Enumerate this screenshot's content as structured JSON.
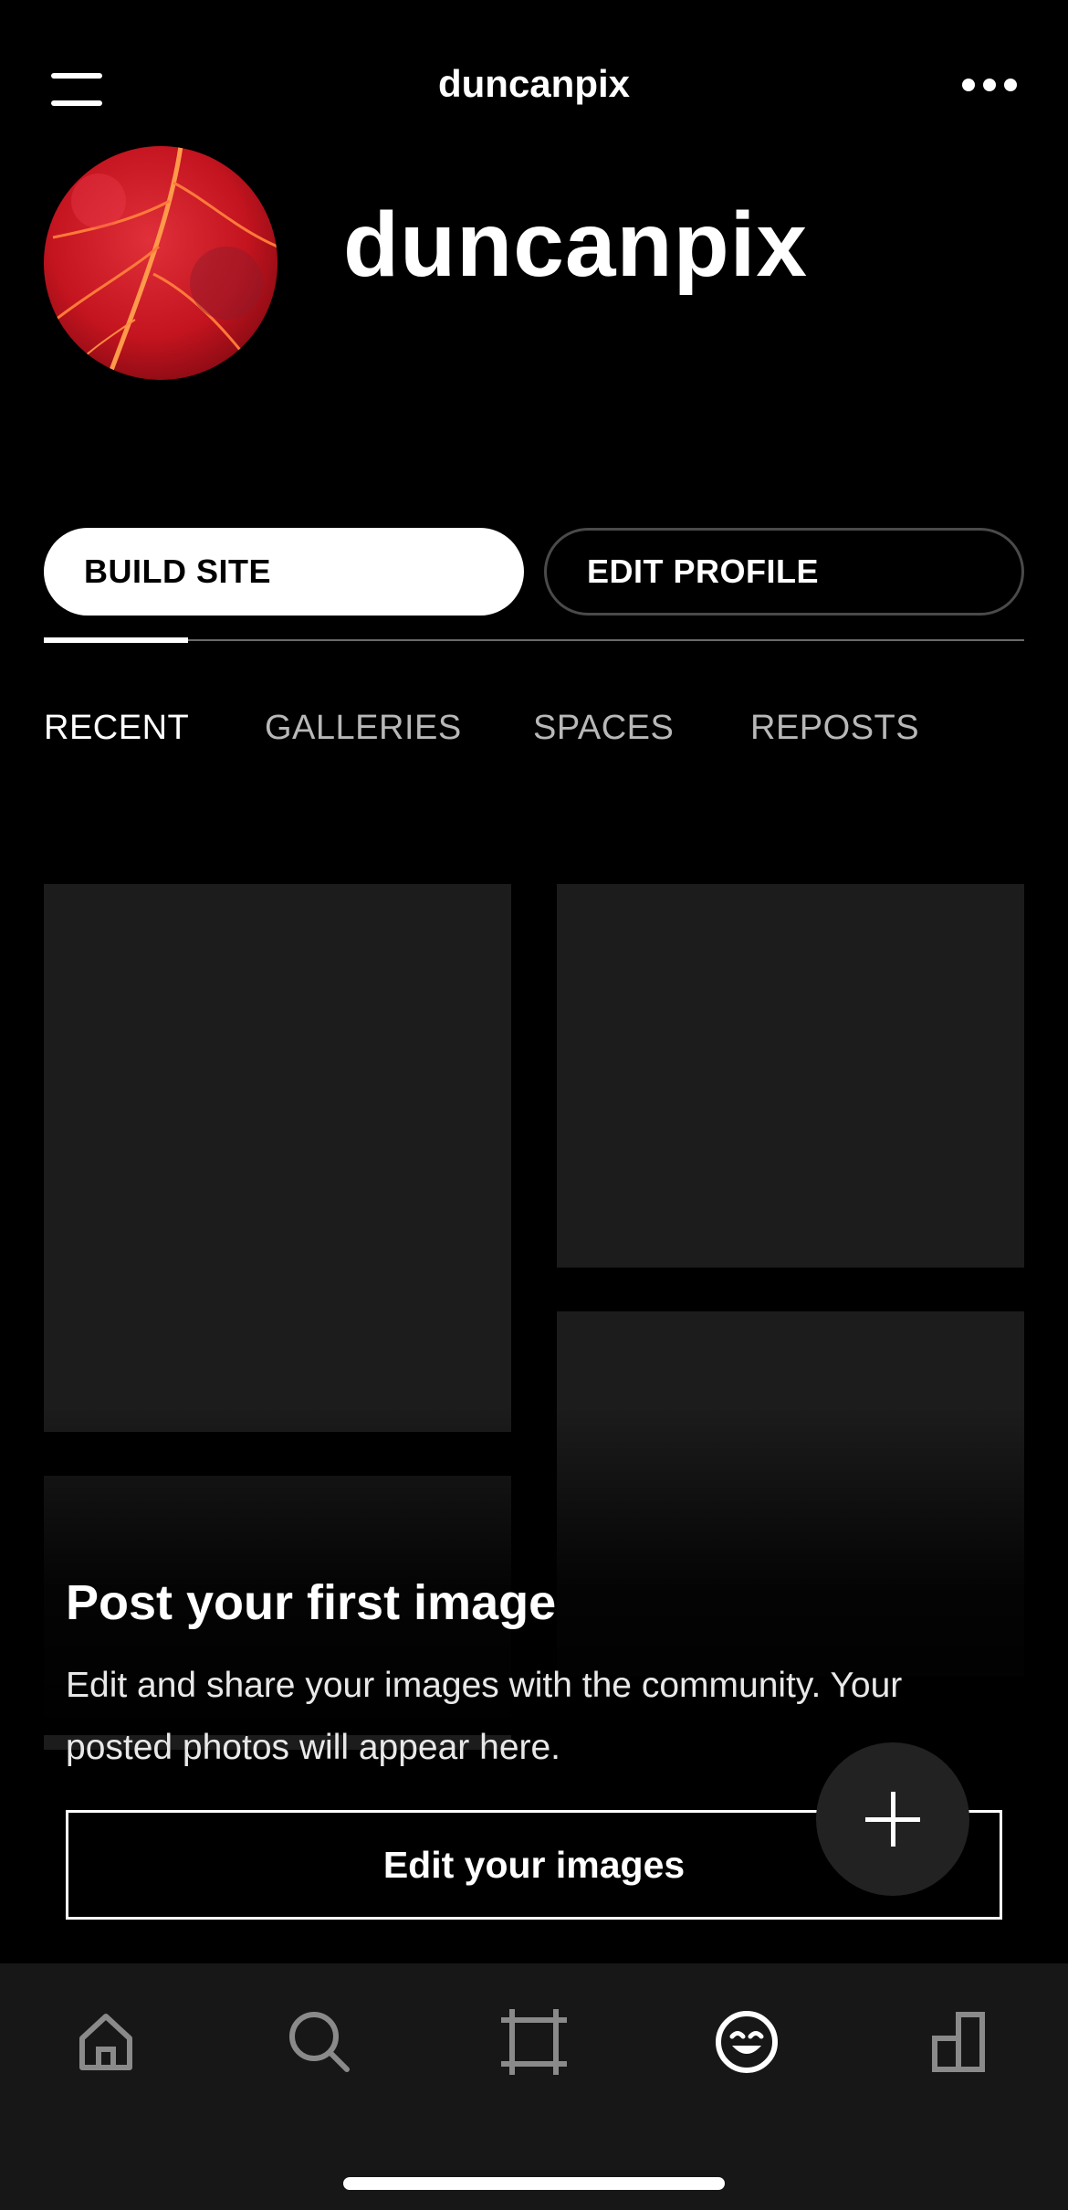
{
  "header": {
    "title": "duncanpix"
  },
  "profile": {
    "name": "duncanpix"
  },
  "actions": {
    "build_site": "BUILD SITE",
    "edit_profile": "EDIT PROFILE"
  },
  "tabs": [
    {
      "label": "RECENT",
      "active": true
    },
    {
      "label": "GALLERIES",
      "active": false
    },
    {
      "label": "SPACES",
      "active": false
    },
    {
      "label": "REPOSTS",
      "active": false
    }
  ],
  "empty_state": {
    "title": "Post your first image",
    "description": "Edit and share your images with the community.  Your posted photos will appear here.",
    "button_label": "Edit your images"
  },
  "bottom_nav": [
    {
      "icon": "home-icon",
      "active": false
    },
    {
      "icon": "search-icon",
      "active": false
    },
    {
      "icon": "crop-icon",
      "active": false
    },
    {
      "icon": "profile-smile-icon",
      "active": true
    },
    {
      "icon": "stats-icon",
      "active": false
    }
  ],
  "colors": {
    "background": "#000000",
    "placeholder": "#1c1c1c",
    "tabbar": "#171717",
    "inactive_icon": "#8a8a8a",
    "active": "#ffffff"
  }
}
